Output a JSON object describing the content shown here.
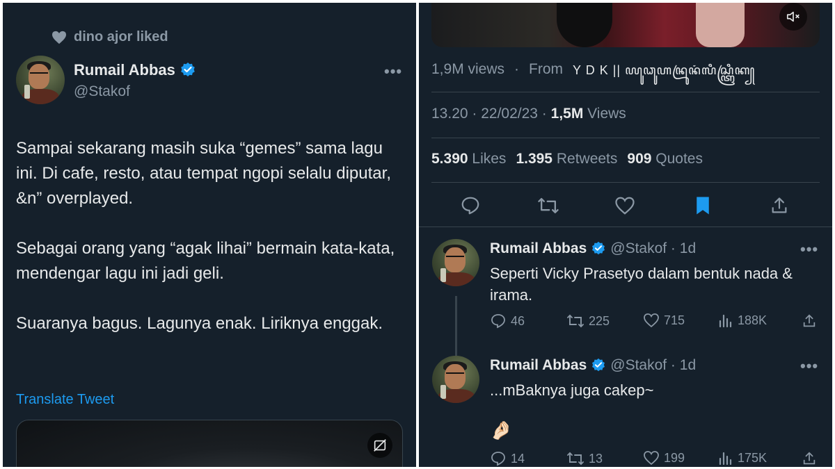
{
  "left": {
    "liked_by": "dino ajor liked",
    "author_name": "Rumail Abbas",
    "author_handle": "@Stakof",
    "paragraphs": [
      "Sampai sekarang masih suka “gemes” sama lagu ini. Di cafe, resto, atau tempat ngopi selalu diputar, &n” overplayed.",
      "Sebagai orang yang “agak lihai” bermain kata-kata, mendengar lagu ini jadi geli.",
      "Suaranya bagus. Lagunya enak. Liriknya enggak."
    ],
    "translate_label": "Translate Tweet",
    "more_label": "•••"
  },
  "right": {
    "views_count": "1,9M views",
    "views_sep": "·",
    "from_label": "From",
    "from_source": "Y D K || ꦪꦸꦣꦸꦲꦤꦿꦸꦤꦁꦭꦶꦱ꧀ꦠꦿꦶꦏ꧀",
    "timestamp": "13.20 · 22/02/23 ·",
    "tweet_views_count": "1,5M",
    "tweet_views_label": "Views",
    "likes_count": "5.390",
    "likes_label": "Likes",
    "retweets_count": "1.395",
    "retweets_label": "Retweets",
    "quotes_count": "909",
    "quotes_label": "Quotes",
    "replies": [
      {
        "name": "Rumail Abbas",
        "handle_time": "@Stakof · 1d",
        "text": "Seperti Vicky Prasetyo dalam bentuk nada & irama.",
        "replies": "46",
        "retweets": "225",
        "likes": "715",
        "views": "188K"
      },
      {
        "name": "Rumail Abbas",
        "handle_time": "@Stakof · 1d",
        "text": "...mBaknya juga cakep~",
        "emoji": "🤌🏻",
        "replies": "14",
        "retweets": "13",
        "likes": "199",
        "views": "175K"
      }
    ],
    "more_label": "•••"
  },
  "colors": {
    "background": "#15202b",
    "text": "#e7e9ea",
    "muted": "#8b98a5",
    "accent": "#1d9bf0",
    "border": "#38444d"
  }
}
